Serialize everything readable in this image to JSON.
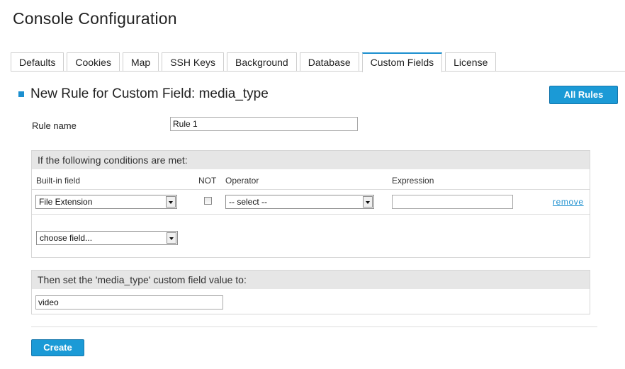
{
  "page": {
    "title": "Console Configuration"
  },
  "tabs": [
    {
      "label": "Defaults"
    },
    {
      "label": "Cookies"
    },
    {
      "label": "Map"
    },
    {
      "label": "SSH Keys"
    },
    {
      "label": "Background"
    },
    {
      "label": "Database"
    },
    {
      "label": "Custom Fields",
      "active": true
    },
    {
      "label": "License"
    }
  ],
  "section": {
    "title": "New Rule for Custom Field: media_type",
    "all_rules_label": "All Rules"
  },
  "rule": {
    "name_label": "Rule name",
    "name_value": "Rule 1"
  },
  "conditions": {
    "header": "If the following conditions are met:",
    "columns": {
      "field": "Built-in field",
      "not": "NOT",
      "operator": "Operator",
      "expression": "Expression"
    },
    "row": {
      "field_value": "File Extension",
      "not_checked": false,
      "operator_value": "-- select --",
      "expression_value": "",
      "remove_label": "remove"
    },
    "choose_field": "choose field..."
  },
  "action": {
    "header": "Then set the 'media_type' custom field value to:",
    "value": "video"
  },
  "create_label": "Create",
  "colors": {
    "accent": "#1b9ad6",
    "panel_header": "#e6e6e6"
  }
}
